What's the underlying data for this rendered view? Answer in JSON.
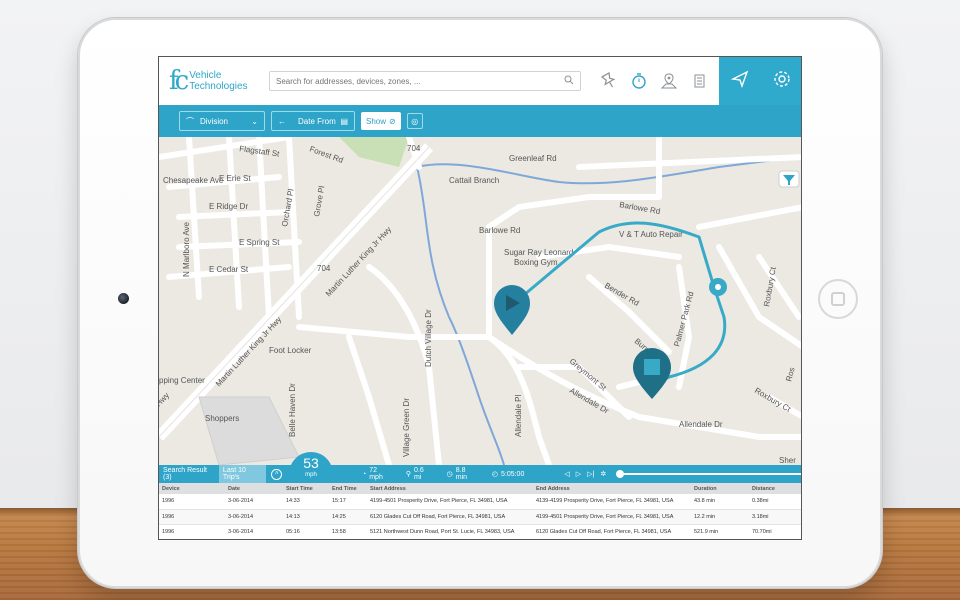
{
  "app": {
    "logo_mark": "fc",
    "logo_line1": "Vehicle",
    "logo_line2": "Technologies",
    "search_placeholder": "Search for addresses, devices, zones, ..."
  },
  "toolbar": {
    "icons": [
      "pin-icon",
      "timer-icon",
      "map-location-icon",
      "document-icon"
    ],
    "right_icons": [
      "send-icon",
      "settings-icon"
    ]
  },
  "filters": {
    "division_label": "Division",
    "date_label": "Date From",
    "show_label": "Show"
  },
  "map": {
    "streets": [
      "Flagstaff St",
      "Forest Rd",
      "Chesapeake Ave",
      "E Erie St",
      "E Ridge Dr",
      "N Marlboro Ave",
      "Orchard Pl",
      "Grove Pl",
      "E Spring St",
      "E Cedar St",
      "Martin Luther King Jr Hwy",
      "Martin Luther King Jr Hwy",
      "Greenleaf Rd",
      "Cattail Branch",
      "Barlowe Rd",
      "Barlowe Rd",
      "V & T Auto Repair",
      "Sugar Ray Leonard",
      "Boxing Gym",
      "Bender Rd",
      "Palmer Park Rd",
      "Burnway",
      "Greymont St",
      "Allendale Dr",
      "Allendale Dr",
      "Allendale Pl",
      "Dutch Village Dr",
      "Village Green Dr",
      "Belle Haven Dr",
      "Foot Locker",
      "Shoppers",
      "pping Center",
      "Hwy",
      "Roxbury Ct",
      "Roxbury Ct",
      "Ros",
      "Sher",
      "704",
      "704"
    ]
  },
  "panel": {
    "tab_results": "Search Result (3)",
    "tab_trips": "Last 10 Trip's",
    "speed_value": "53",
    "speed_unit": "mph",
    "max_speed": "72 mph",
    "distance": "0.6 mi",
    "duration": "8.8 min",
    "time": "5:05:00"
  },
  "table": {
    "headers": [
      "Device",
      "Date",
      "Start Time",
      "End Time",
      "Start Address",
      "End Address",
      "Duration",
      "Distance"
    ],
    "rows": [
      [
        "1996",
        "3-06-2014",
        "14:33",
        "15:17",
        "4199-4501 Prosperity Drive, Fort Pierce, FL 34981, USA",
        "4139-4199 Prosperity Drive, Fort Pierce, FL 34981, USA",
        "43.8 min",
        "0.38mi"
      ],
      [
        "1996",
        "3-06-2014",
        "14:13",
        "14:25",
        "6120 Glades Cut Off Road, Fort Pierce, FL 34981, USA",
        "4199-4501 Prosperity Drive, Fort Pierce, FL 34981, USA",
        "12.2 min",
        "3.18mi"
      ],
      [
        "1996",
        "3-06-2014",
        "05:16",
        "13:58",
        "5121 Northwest Dunn Road, Port St. Lucie, FL 34983, USA",
        "6120 Glades Cut Off Road, Fort Pierce, FL 34981, USA",
        "521.9 min",
        "70.70mi"
      ]
    ]
  },
  "colors": {
    "accent": "#2ea4c8",
    "route": "#38aac8",
    "marker": "#1f6f87"
  }
}
